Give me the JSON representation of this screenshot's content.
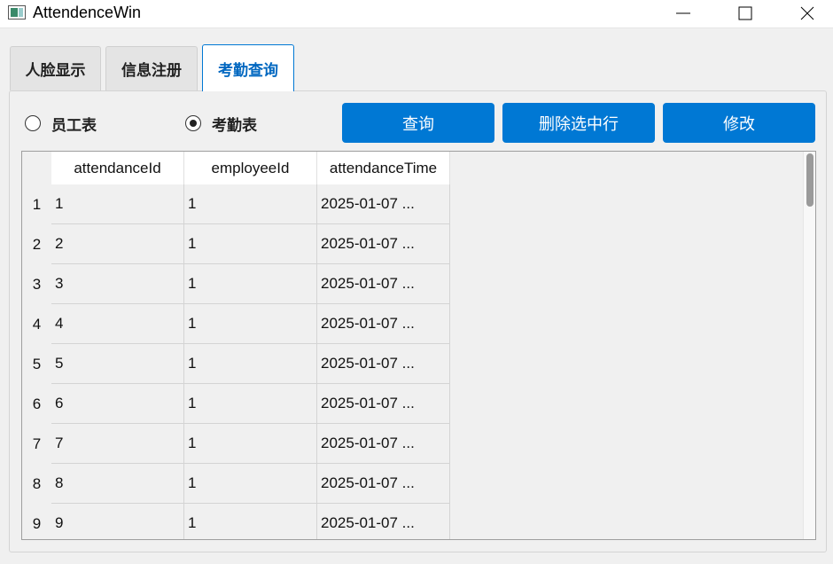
{
  "window": {
    "title": "AttendenceWin",
    "icon": "app-window-icon",
    "controls": [
      "minimize-icon",
      "maximize-icon",
      "close-icon"
    ]
  },
  "tabs": [
    {
      "label": "人脸显示",
      "active": false
    },
    {
      "label": "信息注册",
      "active": false
    },
    {
      "label": "考勤查询",
      "active": true
    }
  ],
  "radios": [
    {
      "label": "员工表",
      "checked": false
    },
    {
      "label": "考勤表",
      "checked": true
    }
  ],
  "buttons": {
    "query": "查询",
    "delete": "删除选中行",
    "modify": "修改"
  },
  "table": {
    "columns": [
      "attendanceId",
      "employeeId",
      "attendanceTime"
    ],
    "rows": [
      {
        "num": "1",
        "attendanceId": "1",
        "employeeId": "1",
        "attendanceTime": "2025-01-07 ..."
      },
      {
        "num": "2",
        "attendanceId": "2",
        "employeeId": "1",
        "attendanceTime": "2025-01-07 ..."
      },
      {
        "num": "3",
        "attendanceId": "3",
        "employeeId": "1",
        "attendanceTime": "2025-01-07 ..."
      },
      {
        "num": "4",
        "attendanceId": "4",
        "employeeId": "1",
        "attendanceTime": "2025-01-07 ..."
      },
      {
        "num": "5",
        "attendanceId": "5",
        "employeeId": "1",
        "attendanceTime": "2025-01-07 ..."
      },
      {
        "num": "6",
        "attendanceId": "6",
        "employeeId": "1",
        "attendanceTime": "2025-01-07 ..."
      },
      {
        "num": "7",
        "attendanceId": "7",
        "employeeId": "1",
        "attendanceTime": "2025-01-07 ..."
      },
      {
        "num": "8",
        "attendanceId": "8",
        "employeeId": "1",
        "attendanceTime": "2025-01-07 ..."
      },
      {
        "num": "9",
        "attendanceId": "9",
        "employeeId": "1",
        "attendanceTime": "2025-01-07 ..."
      }
    ]
  },
  "colors": {
    "accent": "#0078d4",
    "active_tab_text": "#0067c0",
    "background": "#f0f0f0"
  }
}
